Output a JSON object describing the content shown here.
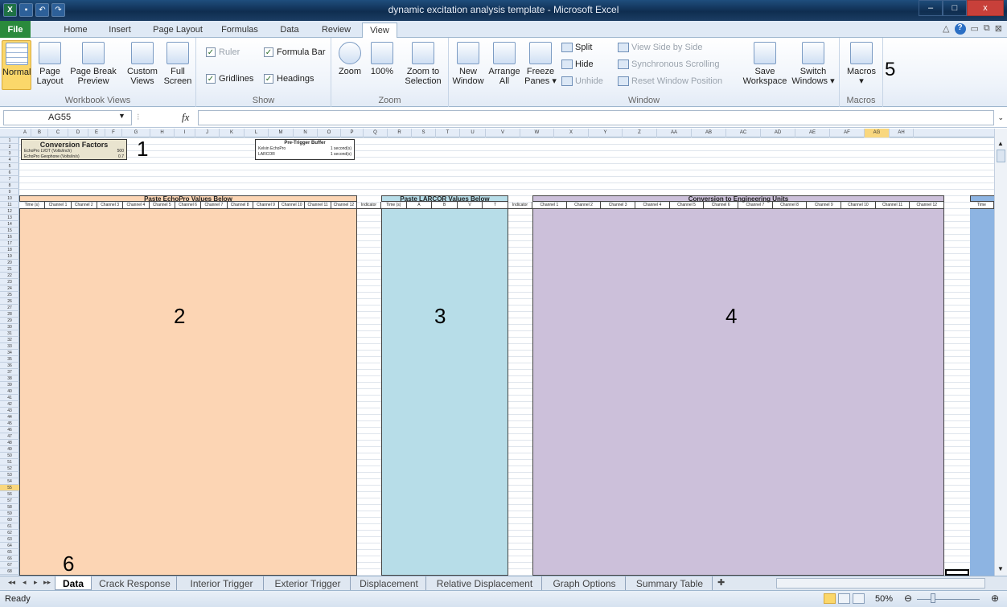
{
  "window": {
    "title": "dynamic excitation analysis template - Microsoft Excel",
    "controls": [
      "–",
      "□",
      "x"
    ]
  },
  "qat": {
    "app_icon": "X",
    "icons": [
      "save-icon",
      "undo-icon",
      "redo-icon"
    ]
  },
  "tabs": [
    "File",
    "Home",
    "Insert",
    "Page Layout",
    "Formulas",
    "Data",
    "Review",
    "View"
  ],
  "active_tab": "View",
  "ribbon": {
    "workbook_views": {
      "label": "Workbook Views",
      "normal": "Normal",
      "page_layout": [
        "Page",
        "Layout"
      ],
      "page_break": [
        "Page Break",
        "Preview"
      ],
      "custom_views": [
        "Custom",
        "Views"
      ],
      "full_screen": [
        "Full",
        "Screen"
      ]
    },
    "show": {
      "label": "Show",
      "ruler": "Ruler",
      "formula_bar": "Formula Bar",
      "gridlines": "Gridlines",
      "headings": "Headings"
    },
    "zoom": {
      "label": "Zoom",
      "zoom": "Zoom",
      "hundred": "100%",
      "zoom_selection": [
        "Zoom to",
        "Selection"
      ]
    },
    "window": {
      "label": "Window",
      "new_window": [
        "New",
        "Window"
      ],
      "arrange_all": [
        "Arrange",
        "All"
      ],
      "freeze_panes": [
        "Freeze",
        "Panes ▾"
      ],
      "split": "Split",
      "hide": "Hide",
      "unhide": "Unhide",
      "view_side": "View Side by Side",
      "sync_scroll": "Synchronous Scrolling",
      "reset_pos": "Reset Window Position",
      "save_workspace": [
        "Save",
        "Workspace"
      ],
      "switch_windows": [
        "Switch",
        "Windows ▾"
      ]
    },
    "macros": {
      "label": "Macros",
      "macros": "Macros"
    }
  },
  "formula_bar": {
    "name_box": "AG55",
    "fx": "fx",
    "value": ""
  },
  "columns": [
    "A",
    "B",
    "C",
    "D",
    "E",
    "F",
    "G",
    "H",
    "I",
    "J",
    "K",
    "L",
    "M",
    "N",
    "O",
    "P",
    "Q",
    "R",
    "S",
    "T",
    "U",
    "V",
    "W",
    "X",
    "Y",
    "Z",
    "AA",
    "AB",
    "AC",
    "AD",
    "AE",
    "AF",
    "AG",
    "AH"
  ],
  "sheet": {
    "conversion_factors": {
      "title": "Conversion Factors",
      "rows": [
        [
          "EchoPro LVDT (Volts/inch)",
          "500"
        ],
        [
          "EchoPro Geophone (Volts/in/s)",
          "0.7"
        ]
      ]
    },
    "pretrigger": {
      "title": "Pre-Trigger Buffer",
      "rows": [
        [
          "Kelvin EchoPro",
          "1 second(s)"
        ],
        [
          "LARCOR",
          "1 second(s)"
        ]
      ]
    },
    "echopro_header": "Paste EchoPro Values Below",
    "larcor_header": "Paste LARCOR Values Below",
    "conversion_header": "Conversion to Engineering Units",
    "echopro_cols": [
      "Time (s)",
      "Channel 1",
      "Channel 2",
      "Channel 3",
      "Channel 4",
      "Channel 5",
      "Channel 6",
      "Channel 7",
      "Channel 8",
      "Channel 9",
      "Channel 10",
      "Channel 11",
      "Channel 12"
    ],
    "larcor_cols": [
      "Time (s)",
      "A",
      "B",
      "V",
      "T"
    ],
    "conv_cols": [
      "Channel 1",
      "Channel 2",
      "Channel 3",
      "Channel 4",
      "Channel 5",
      "Channel 6",
      "Channel 7",
      "Channel 8",
      "Channel 9",
      "Channel 10",
      "Channel 11",
      "Channel 12"
    ],
    "indicator": "Indicator",
    "time_col": "Time",
    "colors": {
      "echopro": "#fcd5b4",
      "larcor": "#b7dde8",
      "conversion": "#ccc0da",
      "right": "#8db4e2"
    }
  },
  "annotations": [
    "1",
    "2",
    "3",
    "4",
    "5",
    "6"
  ],
  "sheet_tabs": [
    "Data",
    "Crack Response",
    "Interior Trigger",
    "Exterior Trigger",
    "Displacement",
    "Relative Displacement",
    "Graph Options",
    "Summary Table"
  ],
  "active_sheet": "Data",
  "status": {
    "ready": "Ready",
    "zoom": "50%"
  }
}
